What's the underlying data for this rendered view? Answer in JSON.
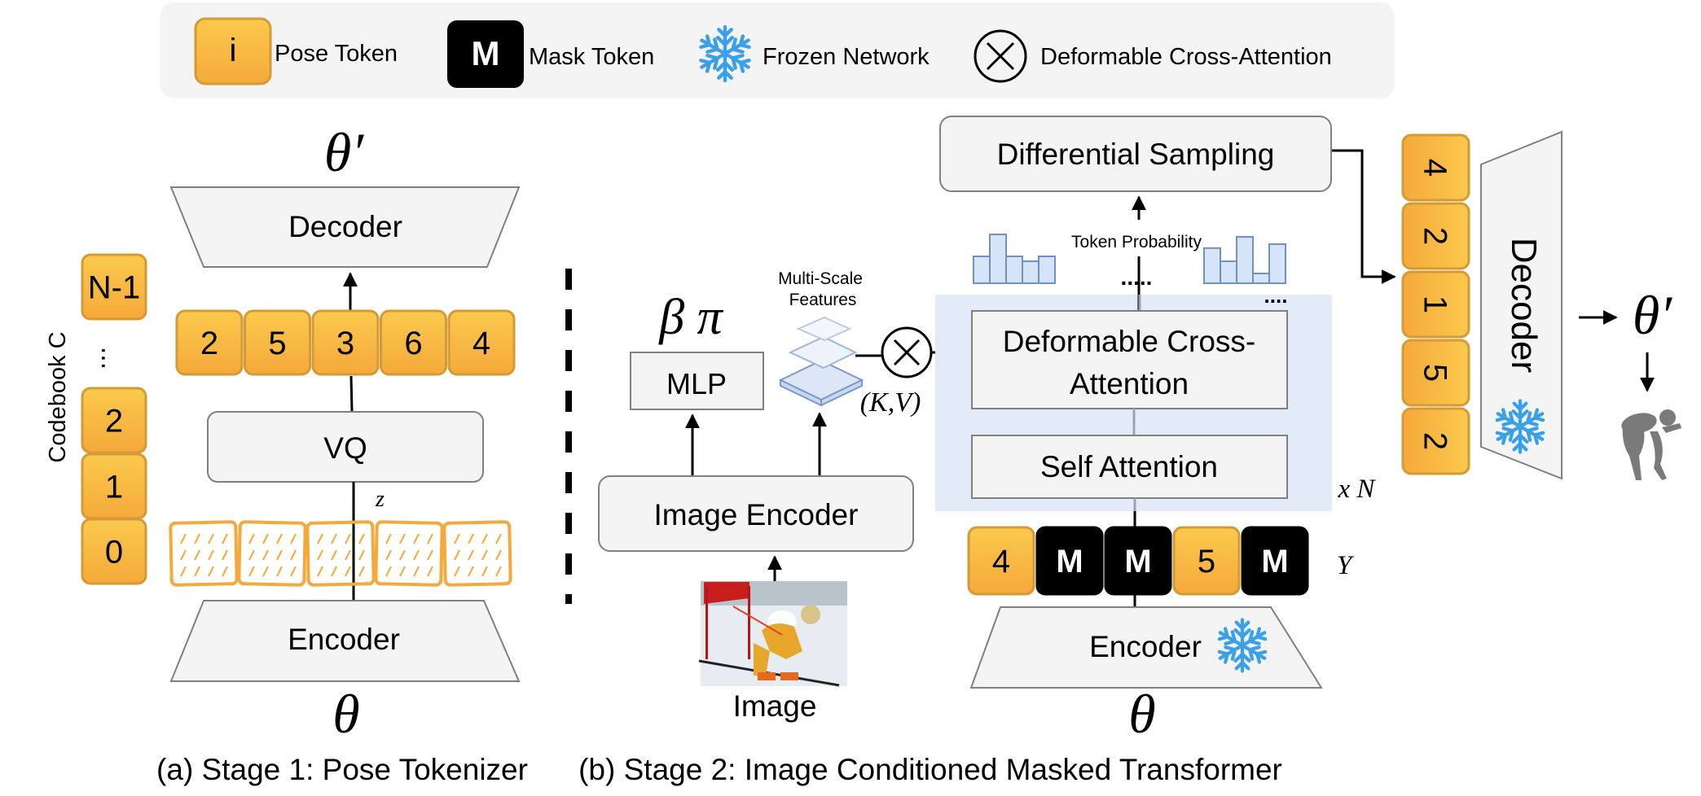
{
  "legend": {
    "pose_token": {
      "glyph": "i",
      "label": "Pose Token"
    },
    "mask_token": {
      "glyph": "M",
      "label": "Mask Token"
    },
    "frozen": {
      "icon": "snowflake-icon",
      "label": "Frozen Network"
    },
    "cross_attn": {
      "icon": "circled-times-icon",
      "label": "Deformable Cross-Attention"
    }
  },
  "colors": {
    "token_top": "#fbc94e",
    "token_bottom": "#f5a93a",
    "token_border": "#d49a35",
    "mask": "#000000",
    "block_fill": "#f4f4f4",
    "block_stroke": "#808080",
    "panel_blue": "#e3ebf8",
    "hist_fill": "#d6e4f7",
    "hist_stroke": "#7091c2",
    "snowflake": "#3aa0ea",
    "squiggle": "#f5a93a",
    "legend_bg": "#f4f4f4"
  },
  "stage1": {
    "theta_prime": "θ′",
    "decoder": "Decoder",
    "tokens": [
      "2",
      "5",
      "3",
      "6",
      "4"
    ],
    "vq": "VQ",
    "z_label": "z",
    "encoder": "Encoder",
    "theta": "θ",
    "codebook_label": "Codebook C",
    "codebook_entries": [
      "N-1",
      "⋮",
      "2",
      "1",
      "0"
    ],
    "caption": "(a) Stage 1: Pose Tokenizer"
  },
  "stage2": {
    "beta_pi": "β  π",
    "mlp": "MLP",
    "multiscale_label_1": "Multi-Scale",
    "multiscale_label_2": "Features",
    "kv": "(K,V)",
    "image_encoder": "Image Encoder",
    "image_label": "Image",
    "differential_sampling": "Differential Sampling",
    "token_probability": "Token Probability",
    "hist_left": [
      0.55,
      1.0,
      0.55,
      0.45,
      0.55
    ],
    "hist_right": [
      0.72,
      0.45,
      0.95,
      0.2,
      0.8
    ],
    "ellipsis": ".....",
    "ellipsis2": "....",
    "deformable_ca_1": "Deformable Cross-",
    "deformable_ca_2": "Attention",
    "self_attention": "Self Attention",
    "xn": "x N",
    "y_tokens": [
      "4",
      "M",
      "M",
      "5",
      "M"
    ],
    "y_label": "Y",
    "encoder": "Encoder",
    "theta": "θ",
    "out_tokens": [
      "4",
      "2",
      "1",
      "5",
      "2"
    ],
    "decoder": "Decoder",
    "theta_prime": "θ′",
    "caption": "(b) Stage 2: Image Conditioned Masked Transformer"
  }
}
